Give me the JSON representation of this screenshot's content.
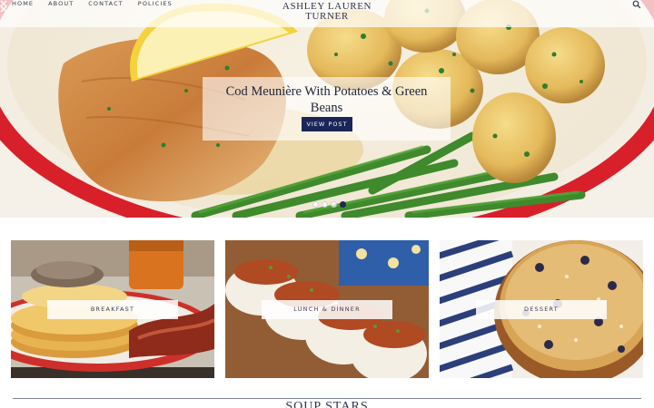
{
  "header": {
    "nav": [
      "HOME",
      "ABOUT",
      "CONTACT",
      "POLICIES"
    ],
    "brand_line1": "ASHLEY LAUREN",
    "brand_line2": "TURNER",
    "search_icon": "search-icon"
  },
  "hero": {
    "title": "Cod Meunière With Potatoes & Green Beans",
    "button": "VIEW POST",
    "slides": 4,
    "active_slide": 1,
    "accent": "#1c2558"
  },
  "categories": [
    {
      "label": "BREAKFAST"
    },
    {
      "label": "LUNCH & DINNER"
    },
    {
      "label": "DESSERT"
    }
  ],
  "section": {
    "title": "SOUP STARS"
  },
  "colors": {
    "navy": "#1c2558",
    "text": "#2f3550",
    "plate_rim": "#d8202a"
  }
}
